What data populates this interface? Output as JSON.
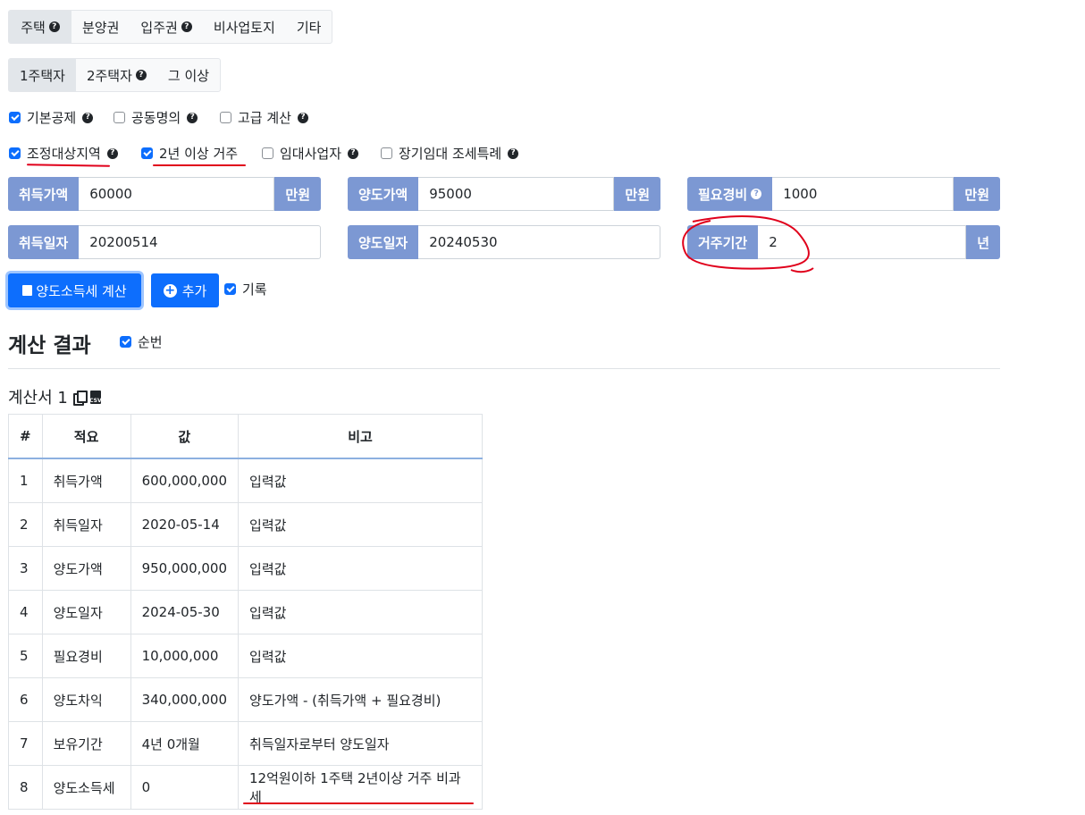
{
  "type_tabs": [
    "주택",
    "분양권",
    "입주권",
    "비사업토지",
    "기타"
  ],
  "house_count_tabs": [
    "1주택자",
    "2주택자",
    "그 이상"
  ],
  "options_row1": [
    {
      "label": "기본공제",
      "checked": true
    },
    {
      "label": "공동명의",
      "checked": false
    },
    {
      "label": "고급 계산",
      "checked": false
    }
  ],
  "options_row2": [
    {
      "label": "조정대상지역",
      "checked": true
    },
    {
      "label": "2년 이상 거주",
      "checked": true
    },
    {
      "label": "임대사업자",
      "checked": false
    },
    {
      "label": "장기임대 조세특례",
      "checked": false
    }
  ],
  "fields": {
    "acq_price": {
      "label": "취득가액",
      "value": "60000",
      "unit": "만원"
    },
    "sale_price": {
      "label": "양도가액",
      "value": "95000",
      "unit": "만원"
    },
    "expense": {
      "label": "필요경비",
      "value": "1000",
      "unit": "만원"
    },
    "acq_date": {
      "label": "취득일자",
      "value": "20200514"
    },
    "sale_date": {
      "label": "양도일자",
      "value": "20240530"
    },
    "residence": {
      "label": "거주기간",
      "value": "2",
      "unit": "년"
    }
  },
  "buttons": {
    "calc": "양도소득세 계산",
    "add": "추가",
    "record": "기록"
  },
  "result": {
    "heading": "계산 결과",
    "seq_label": "순번",
    "sheet_title": "계산서 1"
  },
  "table": {
    "headers": [
      "#",
      "적요",
      "값",
      "비고"
    ],
    "rows": [
      [
        "1",
        "취득가액",
        "600,000,000",
        "입력값"
      ],
      [
        "2",
        "취득일자",
        "2020-05-14",
        "입력값"
      ],
      [
        "3",
        "양도가액",
        "950,000,000",
        "입력값"
      ],
      [
        "4",
        "양도일자",
        "2024-05-30",
        "입력값"
      ],
      [
        "5",
        "필요경비",
        "10,000,000",
        "입력값"
      ],
      [
        "6",
        "양도차익",
        "340,000,000",
        "양도가액 - (취득가액 + 필요경비)"
      ],
      [
        "7",
        "보유기간",
        "4년 0개월",
        "취득일자로부터 양도일자"
      ],
      [
        "8",
        "양도소득세",
        "0",
        "12억원이하 1주택 2년이상 거주 비과세"
      ]
    ]
  }
}
